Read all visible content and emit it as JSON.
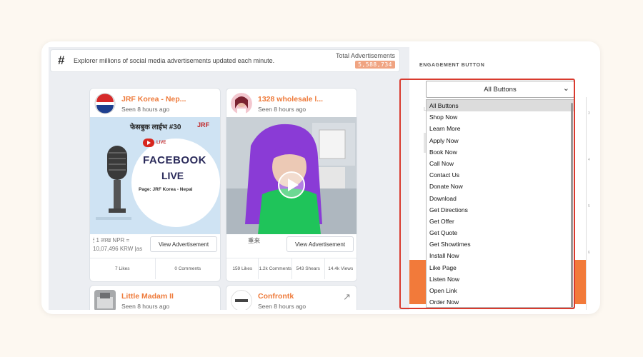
{
  "header": {
    "hash_symbol": "#",
    "search_text": "Explorer millions of social media advertisements updated each minute.",
    "total_label": "Total Advertisements",
    "total_count": "5,588,734"
  },
  "cards": [
    {
      "name": "JRF Korea - Nep...",
      "seen": "Seen 8 hours ago",
      "poster_heading": "फेसबुक लाईभ #30",
      "poster_brand": "JRF",
      "poster_live": "LIVE",
      "poster_title_1": "FACEBOOK",
      "poster_title_2": "LIVE",
      "poster_page": "Page: JRF Korea - Nepal",
      "description": "🕯 1 लाख NPR = 10,07,496 KRW |as",
      "view_label": "View Advertisement",
      "stats": [
        "7 Likes",
        "0 Comments"
      ]
    },
    {
      "name": "1328 wholesale l...",
      "seen": "Seen 8 hours ago",
      "description": "重来",
      "view_label": "View Advertisement",
      "stats": [
        "159 Likes",
        "1.2k Comments",
        "543 Shears",
        "14.4k Views"
      ]
    },
    {
      "name": "Little Madam II",
      "seen": "Seen 8 hours ago"
    },
    {
      "name": "Confrontk",
      "seen": "Seen 8 hours ago",
      "arrow": "↗"
    }
  ],
  "panel": {
    "engagement_label": "ENGAGEMENT BUTTON",
    "faint_letter": "L",
    "select_value": "All Buttons",
    "caret": "⌄",
    "options": [
      "All Buttons",
      "Shop Now",
      "Learn More",
      "Apply Now",
      "Book Now",
      "Call Now",
      "Contact Us",
      "Donate Now",
      "Download",
      "Get Directions",
      "Get Offer",
      "Get Quote",
      "Get Showtimes",
      "Install Now",
      "Like Page",
      "Listen Now",
      "Open Link",
      "Order Now"
    ],
    "ruler_marks": [
      "3",
      "4",
      "5",
      "6"
    ]
  },
  "colors": {
    "accent": "#ee7a3a",
    "highlight": "#d93a2e",
    "orange_button": "#f27a3a"
  }
}
